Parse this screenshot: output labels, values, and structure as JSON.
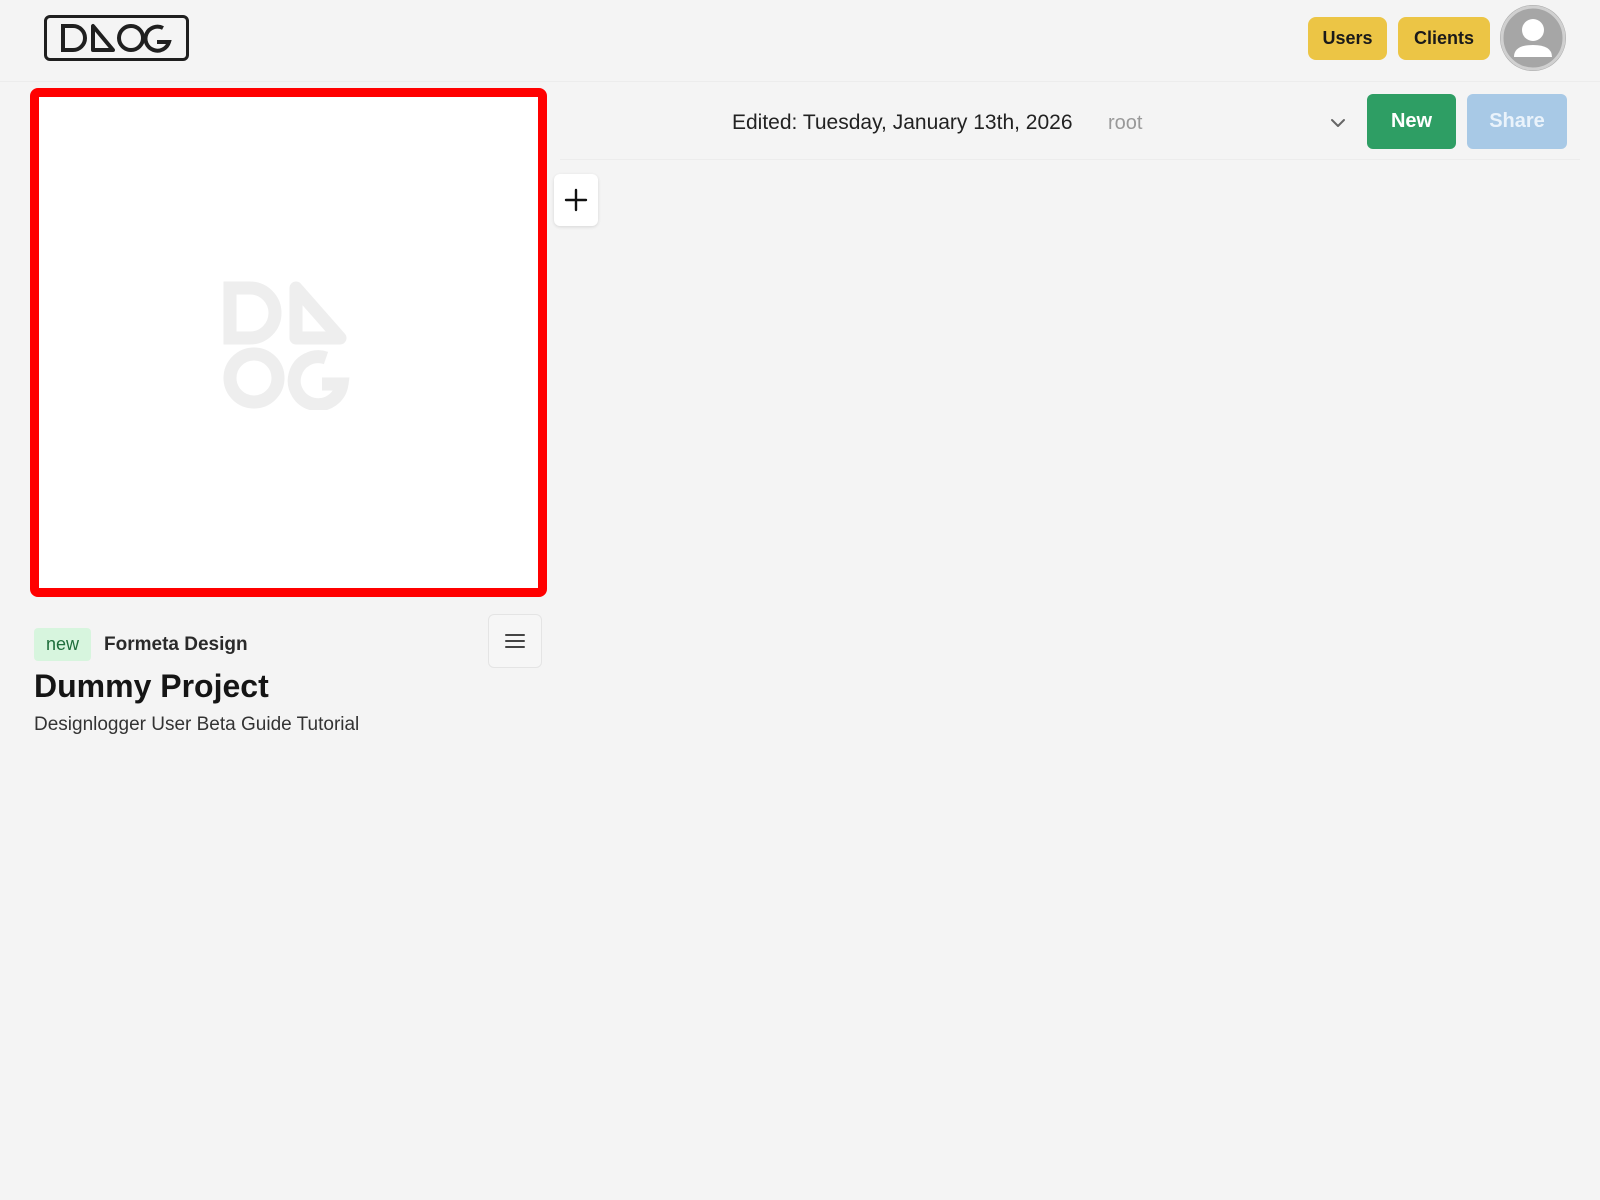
{
  "header": {
    "logo_text": "DAOG",
    "users_label": "Users",
    "clients_label": "Clients"
  },
  "toolbar": {
    "edited_text": "Edited: Tuesday, January 13th, 2026",
    "folder_value": "root",
    "new_label": "New",
    "share_label": "Share"
  },
  "project": {
    "status_badge": "new",
    "client": "Formeta Design",
    "title": "Dummy Project",
    "description": "Designlogger User Beta Guide Tutorial"
  },
  "colors": {
    "highlight_border": "#ff0000",
    "accent_yellow": "#ecc545",
    "new_green": "#2e9e64",
    "share_blue_disabled": "#a8c9e6",
    "badge_green_bg": "#d7f5de"
  },
  "icons": [
    "logo-icon",
    "avatar-icon",
    "chevron-down-icon",
    "plus-icon",
    "hamburger-menu-icon",
    "logo-watermark-icon"
  ]
}
